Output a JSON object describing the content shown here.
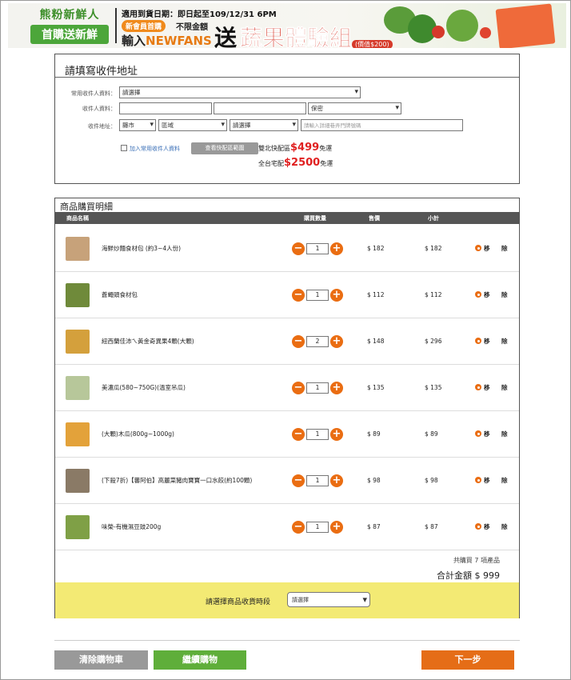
{
  "banner": {
    "brand_line1": "熊粉新鮮人",
    "brand_line2": "首購送新鮮",
    "date_line": "適用到貨日期：即日起至109/12/31 6PM",
    "new_member": "新會員首購",
    "no_limit": "不限金額",
    "input_prefix": "輸入",
    "code": "NEWFANS",
    "send": "送",
    "gift": "蔬果體驗組",
    "price_note": "(價值$200)"
  },
  "address": {
    "title": "請填寫收件地址",
    "common_label": "常用收件人資料：",
    "common_select": "請選擇",
    "recipient_label": "收件人資料：",
    "gender_select": "保密",
    "address_label": "收件地址：",
    "county_select": "縣市",
    "district_select": "區域",
    "road_select": "請選擇",
    "detail_placeholder": "請輸入詳細巷弄門牌號碼",
    "save_checkbox": "加入常用收件人資料",
    "zone_button": "查看快配區範圍",
    "ship1_prefix": "雙北快配區",
    "ship1_amount": "$499",
    "ship1_suffix": "免運",
    "ship2_prefix": "全台宅配",
    "ship2_amount": "$2500",
    "ship2_suffix": "免運"
  },
  "order": {
    "title": "商品購買明細",
    "headers": {
      "name": "商品名稱",
      "qty": "購買數量",
      "price": "售價",
      "subtotal": "小計"
    },
    "items": [
      {
        "name": "海鮮炒麵食材包 (約3~4人份)",
        "qty": "1",
        "price": "$ 182",
        "subtotal": "$ 182",
        "thumb_color": "#c7a27a",
        "remove_1": "移",
        "remove_2": "除"
      },
      {
        "name": "蒼蠅頭食材包",
        "qty": "1",
        "price": "$ 112",
        "subtotal": "$ 112",
        "thumb_color": "#6f8a3a",
        "remove_1": "移",
        "remove_2": "除"
      },
      {
        "name": "紐西蘭佳沛ㄟ黃金奇異果4顆(大顆)",
        "qty": "2",
        "price": "$ 148",
        "subtotal": "$ 296",
        "thumb_color": "#d4a03c",
        "remove_1": "移",
        "remove_2": "除"
      },
      {
        "name": "美濃瓜(580~750G)(溫室吊瓜)",
        "qty": "1",
        "price": "$ 135",
        "subtotal": "$ 135",
        "thumb_color": "#b7c79a",
        "remove_1": "移",
        "remove_2": "除"
      },
      {
        "name": "(大顆)木瓜(800g~1000g)",
        "qty": "1",
        "price": "$ 89",
        "subtotal": "$ 89",
        "thumb_color": "#e3a23a",
        "remove_1": "移",
        "remove_2": "除"
      },
      {
        "name": "(下殺7折)【蕃阿伯】高麗菜豬肉寶寶一口水餃(約100顆)",
        "qty": "1",
        "price": "$ 98",
        "subtotal": "$ 98",
        "thumb_color": "#8a7a66",
        "remove_1": "移",
        "remove_2": "除"
      },
      {
        "name": "味榮-有機濕豆豉200g",
        "qty": "1",
        "price": "$ 87",
        "subtotal": "$ 87",
        "thumb_color": "#7fa046",
        "remove_1": "移",
        "remove_2": "除"
      }
    ],
    "count_text": "共購買 7 項產品",
    "total_text": "合計金額 $ 999",
    "delivery_label": "請選擇商品收貨時段",
    "delivery_select": "請選擇"
  },
  "buttons": {
    "clear": "清除購物車",
    "continue": "繼續購物",
    "next": "下一步"
  }
}
